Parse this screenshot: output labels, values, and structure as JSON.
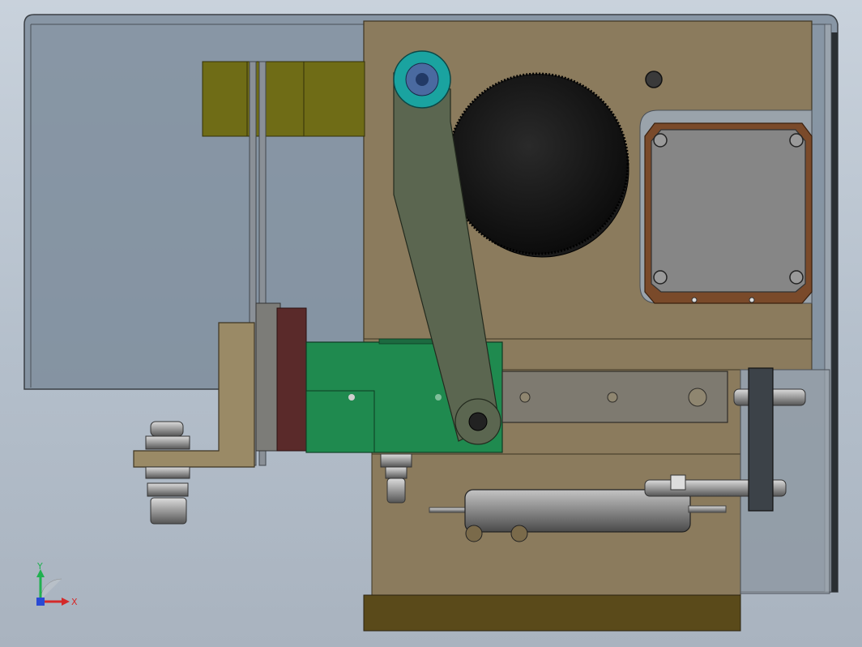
{
  "viewport": {
    "colors": {
      "background_top": "#c9d2dc",
      "background_bottom": "#a9b3bf",
      "housing_glass": "#7d8c9b",
      "base_plate": "#8b7b5d",
      "yellow_block": "#6f6c16",
      "green_block": "#1f8a4f",
      "maroon_block": "#5a2a2a",
      "arm": "#5b6650",
      "teal_pulley": "#1aa3a0",
      "motor_flange": "#7a4a2a",
      "cylinder": "#8e8e8e",
      "bottom_bar": "#5a4a1a"
    }
  },
  "triad": {
    "x_label": "X",
    "y_label": "Y",
    "x_color": "#d42a2a",
    "y_color": "#20b050",
    "z_color": "#2a4ad4"
  }
}
